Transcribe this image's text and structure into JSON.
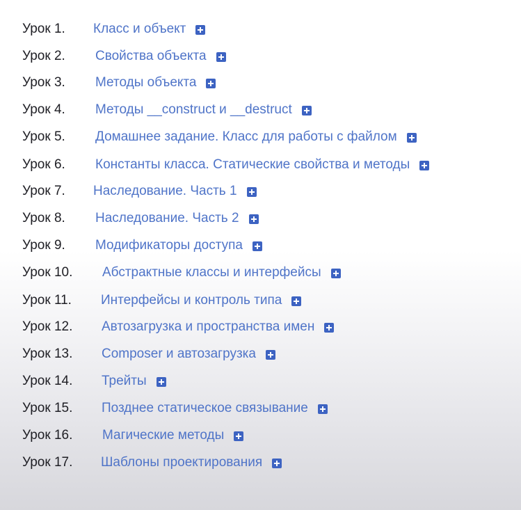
{
  "lessons": [
    {
      "number": "Урок 1.",
      "title": "Класс и объект",
      "icon": "plus-square-icon"
    },
    {
      "number": "Урок 2.",
      "title": "Свойства объекта",
      "icon": "plus-square-icon"
    },
    {
      "number": "Урок 3.",
      "title": "Методы объекта",
      "icon": "plus-square-icon"
    },
    {
      "number": "Урок 4.",
      "title": "Методы __construct и __destruct",
      "icon": "plus-square-icon"
    },
    {
      "number": "Урок 5.",
      "title": "Домашнее задание. Класс для работы с файлом",
      "icon": "plus-square-icon"
    },
    {
      "number": "Урок 6.",
      "title": "Константы класса. Статические свойства и методы",
      "icon": "plus-square-icon"
    },
    {
      "number": "Урок 7.",
      "title": "Наследование. Часть 1",
      "icon": "plus-square-icon"
    },
    {
      "number": "Урок 8.",
      "title": "Наследование. Часть 2",
      "icon": "plus-square-icon"
    },
    {
      "number": "Урок 9.",
      "title": "Модификаторы доступа",
      "icon": "plus-square-icon"
    },
    {
      "number": "Урок 10.",
      "title": "Абстрактные классы и интерфейсы",
      "icon": "plus-square-icon"
    },
    {
      "number": "Урок 11.",
      "title": "Интерфейсы и контроль типа",
      "icon": "plus-square-icon"
    },
    {
      "number": "Урок 12.",
      "title": "Автозагрузка и пространства имен",
      "icon": "plus-square-icon"
    },
    {
      "number": "Урок 13.",
      "title": "Composer и автозагрузка",
      "icon": "plus-square-icon"
    },
    {
      "number": "Урок 14.",
      "title": "Трейты",
      "icon": "plus-square-icon"
    },
    {
      "number": "Урок 15.",
      "title": "Позднее статическое связывание",
      "icon": "plus-square-icon"
    },
    {
      "number": "Урок 16.",
      "title": "Магические методы",
      "icon": "plus-square-icon"
    },
    {
      "number": "Урок 17.",
      "title": "Шаблоны проектирования",
      "icon": "plus-square-icon"
    }
  ],
  "colors": {
    "link": "#4f74c8",
    "number_text": "#1e1e24",
    "icon_fill": "#3d63c2"
  }
}
